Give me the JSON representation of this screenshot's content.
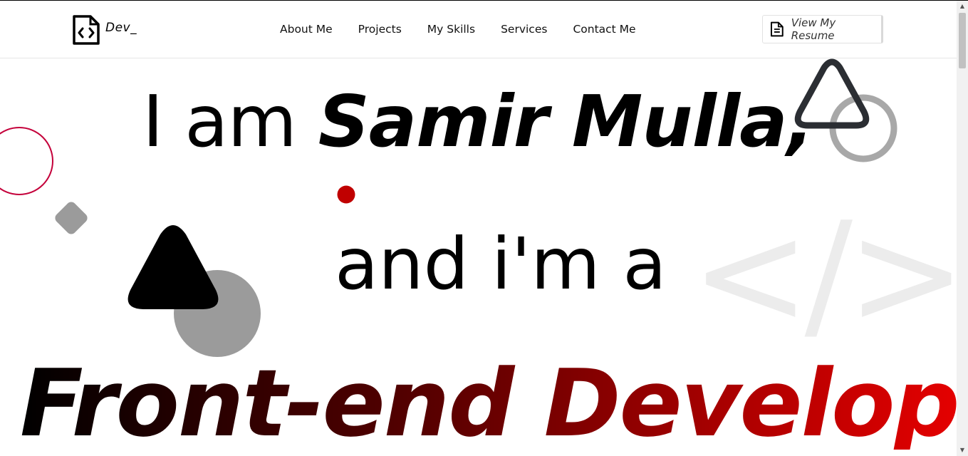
{
  "header": {
    "logo_text": "Dev_",
    "nav": [
      "About Me",
      "Projects",
      "My Skills",
      "Services",
      "Contact Me"
    ],
    "resume_label": "View My Resume"
  },
  "hero": {
    "intro": "I am ",
    "name": "Samir Mulla,",
    "connector": "and i'm a",
    "role": "Front-end Developer",
    "background_code": "</>"
  },
  "colors": {
    "accent_red": "#c4003a",
    "dot_red": "#c00000",
    "gradient_end": "#ff0000"
  },
  "icons": [
    "code-file-icon",
    "document-icon"
  ]
}
